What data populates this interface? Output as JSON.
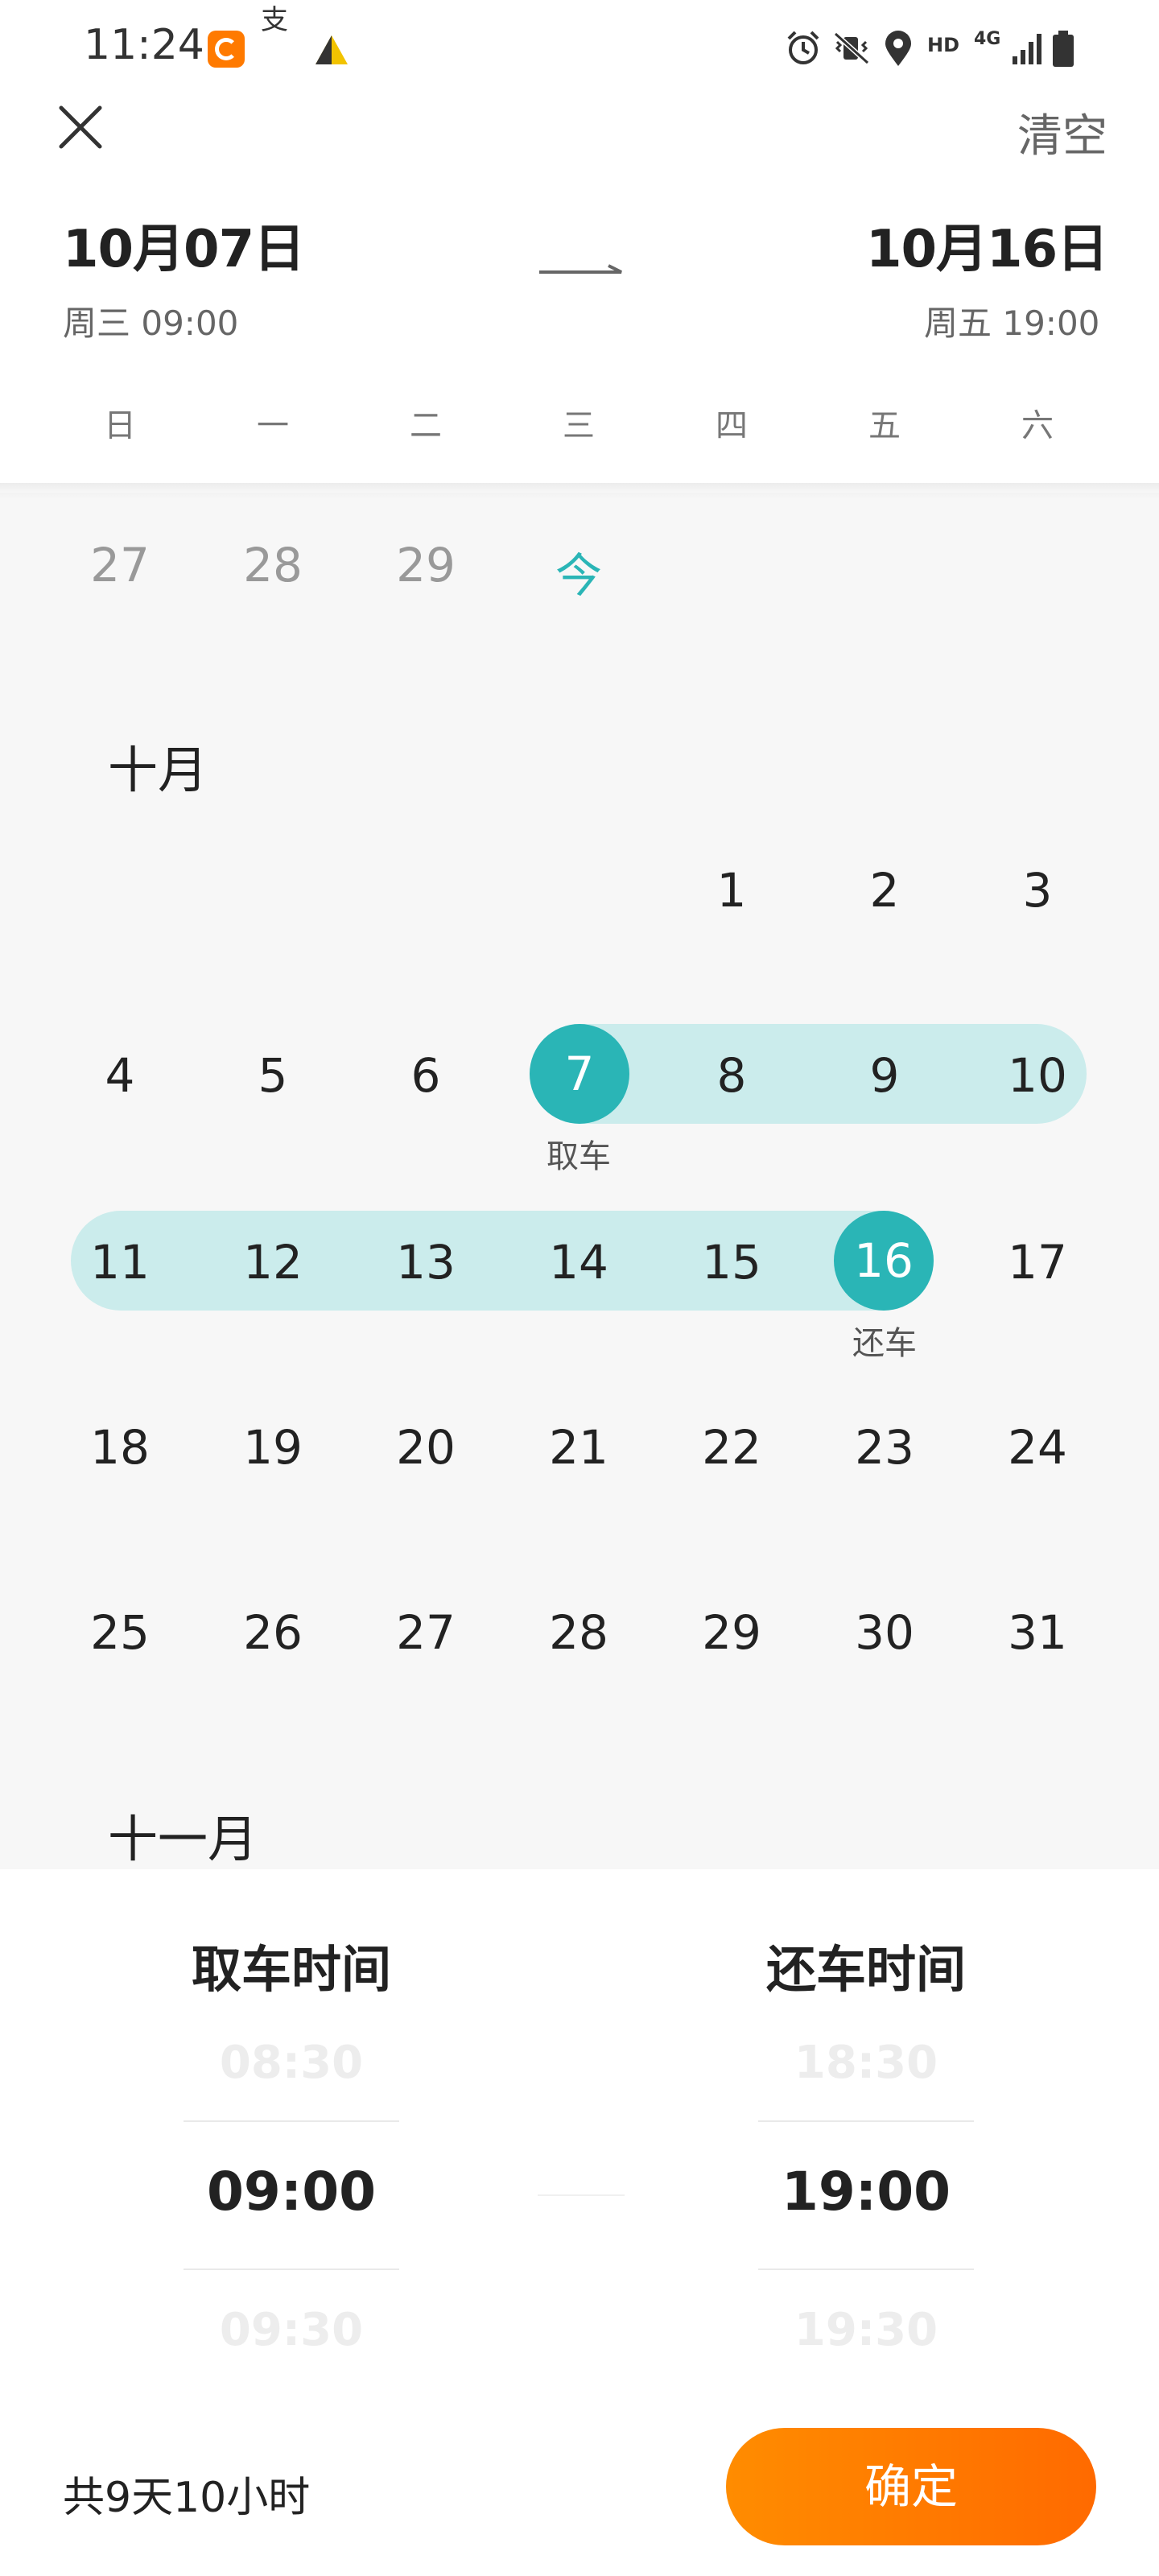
{
  "status_bar": {
    "time": "11:24",
    "icons": [
      "app-icon",
      "alipay-icon",
      "warning-icon",
      "alarm-icon",
      "vibrate-mute-icon",
      "location-icon",
      "signal-icon",
      "battery-icon"
    ],
    "hd": "HD",
    "network": "4G"
  },
  "header": {
    "clear_label": "清空",
    "start_date": "10月07日",
    "start_sub": "周三 09:00",
    "end_date": "10月16日",
    "end_sub": "周五 19:00"
  },
  "weekdays": [
    "日",
    "一",
    "二",
    "三",
    "四",
    "五",
    "六"
  ],
  "calendar": {
    "prev_month_days": [
      "27",
      "28",
      "29"
    ],
    "today_label": "今",
    "october_title": "十月",
    "october_rows": [
      [
        "",
        "",
        "",
        "",
        "1",
        "2",
        "3"
      ],
      [
        "4",
        "5",
        "6",
        "7",
        "8",
        "9",
        "10"
      ],
      [
        "11",
        "12",
        "13",
        "14",
        "15",
        "16",
        "17"
      ],
      [
        "18",
        "19",
        "20",
        "21",
        "22",
        "23",
        "24"
      ],
      [
        "25",
        "26",
        "27",
        "28",
        "29",
        "30",
        "31"
      ]
    ],
    "pickup_label": "取车",
    "return_label": "还车",
    "november_title": "十一月"
  },
  "picker": {
    "pickup_title": "取车时间",
    "pickup_prev": "08:30",
    "pickup_selected": "09:00",
    "pickup_next": "09:30",
    "return_title": "还车时间",
    "return_prev": "18:30",
    "return_selected": "19:00",
    "return_next": "19:30"
  },
  "footer": {
    "duration": "共9天10小时",
    "confirm_label": "确定"
  },
  "colors": {
    "accent": "#2ab5b6",
    "range_fill": "#cbecec",
    "confirm_start": "#ff8c00",
    "confirm_end": "#ff6a00"
  }
}
